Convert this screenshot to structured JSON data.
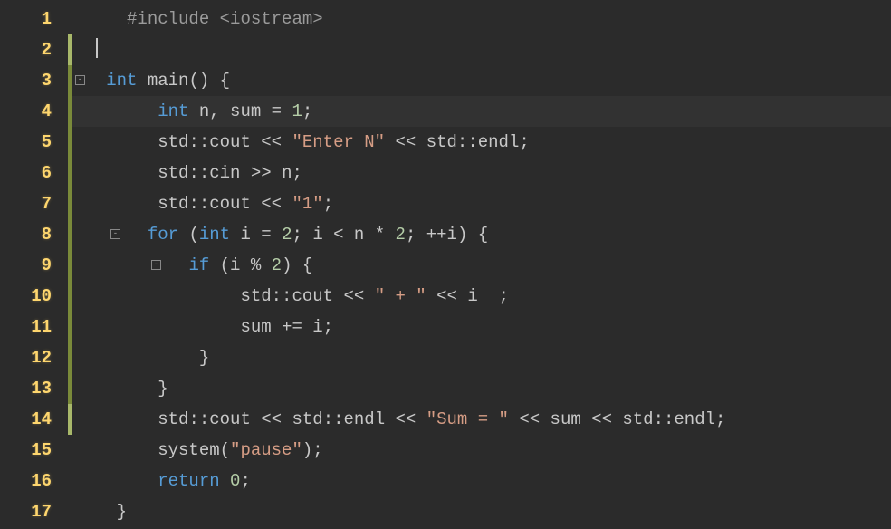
{
  "lines": {
    "l1": {
      "num": "1"
    },
    "l2": {
      "num": "2"
    },
    "l3": {
      "num": "3"
    },
    "l4": {
      "num": "4"
    },
    "l5": {
      "num": "5"
    },
    "l6": {
      "num": "6"
    },
    "l7": {
      "num": "7"
    },
    "l8": {
      "num": "8"
    },
    "l9": {
      "num": "9"
    },
    "l10": {
      "num": "10"
    },
    "l11": {
      "num": "11"
    },
    "l12": {
      "num": "12"
    },
    "l13": {
      "num": "13"
    },
    "l14": {
      "num": "14"
    },
    "l15": {
      "num": "15"
    },
    "l16": {
      "num": "16"
    },
    "l17": {
      "num": "17"
    }
  },
  "code": {
    "include": "#include",
    "iostream_open": "<",
    "iostream": "iostream",
    "iostream_close": ">",
    "int": "int",
    "main": " main() {",
    "int2": "int",
    "vars": " n, sum = ",
    "one": "1",
    "semi": ";",
    "std": "std",
    "scope": "::",
    "cout": "cout",
    "ltlt": " << ",
    "enter_n": "\"Enter N\"",
    "endl": "endl",
    "cin": "cin",
    "gtgt": " >> ",
    "n_var": "n",
    "str_one": "\"1\"",
    "for": "for",
    "for_open": " (",
    "int3": "int",
    "i_eq": " i = ",
    "two": "2",
    "semi_sp": "; ",
    "i_lt": "i < n * ",
    "two2": "2",
    "semi_sp2": "; ",
    "inc_i": "++i) {",
    "if": "if",
    "if_cond": " (i % ",
    "two3": "2",
    "if_close": ") {",
    "plus_str": "\" + \"",
    "i_var": "i  ",
    "sum_plus": "sum += i;",
    "close_brace": "}",
    "sum_str": "\"Sum = \"",
    "sum_var": "sum",
    "system": "system(",
    "pause": "\"pause\"",
    "sys_close": ");",
    "return": "return",
    "zero": " 0",
    "return_semi": ";"
  }
}
